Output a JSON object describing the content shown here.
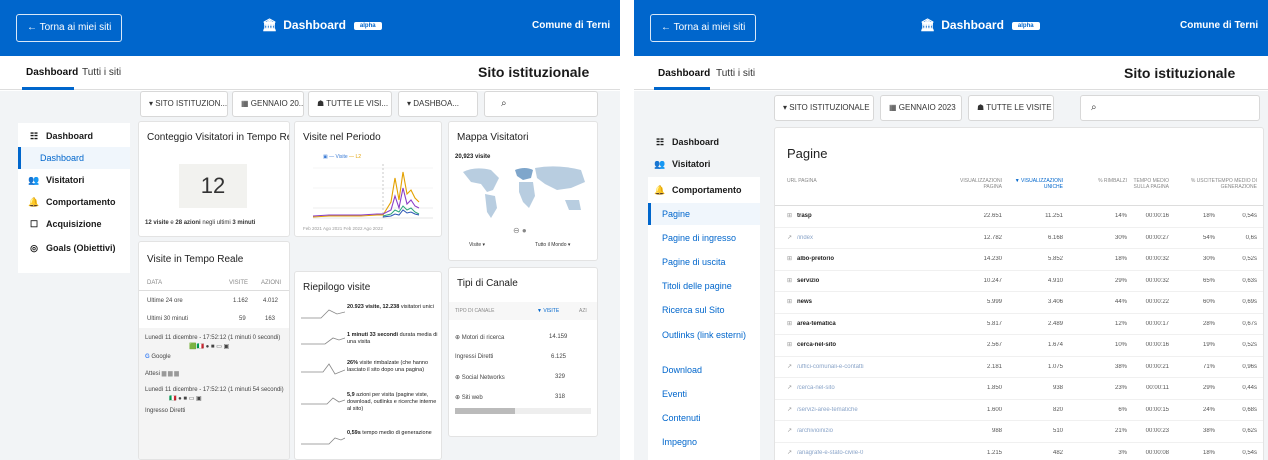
{
  "left": {
    "topbar": {
      "back_label": "← Torna ai miei siti",
      "brand": "Dashboard",
      "badge": "alpha",
      "org": "Comune di Terni"
    },
    "tabs": [
      "Dashboard",
      "Tutti i siti"
    ],
    "site_title": "Sito istituzionale",
    "filters": [
      "▾ SITO ISTITUZION...",
      "▦ GENNAIO 20...",
      "☗ TUTTE LE VISI...",
      "▾ DASHBOA..."
    ],
    "sidebar": {
      "items": [
        "Dashboard",
        "Visitatori",
        "Comportamento",
        "Acquisizione",
        "Goals (Obiettivi)"
      ],
      "sub": "Dashboard"
    },
    "realtime": {
      "title": "Conteggio Visitatori in Tempo Reale",
      "count": "12",
      "summary_a": "12 visite",
      "summary_b": " e ",
      "summary_c": "28 azioni",
      "summary_d": " negli ultimi ",
      "summary_e": "3 minuti"
    },
    "period": {
      "title": "Visite nel Periodo",
      "legend1": "Visite",
      "legend2": "L2",
      "xlabels": "Feb 2021 Ago 2021 Feb 2022 Ago 2022"
    },
    "map": {
      "title": "Mappa Visitatori",
      "visits": "20,923 visite",
      "sel1": "Visite",
      "sel2": "Tutto il Mondo"
    },
    "live": {
      "title": "Visite in Tempo Reale",
      "head": [
        "DATA",
        "VISITE",
        "AZIONI"
      ],
      "rows": [
        [
          "Ultime 24 ore",
          "1.162",
          "4.012"
        ],
        [
          "Ultimi 30 minuti",
          "59",
          "163"
        ]
      ],
      "v1": "Lunedì 11 dicembre - 17:52:12 (1 minuti 0 secondi)",
      "g": "Google",
      "v2": "Attesi",
      "v3": "Lunedì 11 dicembre - 17:52:12 (1 minuti 54 secondi)",
      "v4": "Ingresso Diretti"
    },
    "summary": {
      "title": "Riepilogo visite",
      "items": [
        {
          "strong": "20.923 visite, 12.238",
          "rest": " visitatori unici"
        },
        {
          "strong": "1 minuti 33 secondi",
          "rest": " durata media di una visita"
        },
        {
          "strong": "26%",
          "rest": " visite rimbalzate (che hanno lasciato il sito dopo una pagina)"
        },
        {
          "strong": "5,9",
          "rest": " azioni per visita (pagine viste, download, outlinks e ricerche interne al sito)"
        },
        {
          "strong": "0,59s",
          "rest": " tempo medio di generazione"
        }
      ]
    },
    "channels": {
      "title": "Tipi di Canale",
      "head": [
        "TIPO DI CANALE",
        "▼ VISITE",
        "AZI"
      ],
      "rows": [
        [
          "Motori di ricerca",
          "14.159"
        ],
        [
          "Ingressi Diretti",
          "6.125"
        ],
        [
          "Social Networks",
          "329"
        ],
        [
          "Siti web",
          "318"
        ]
      ]
    }
  },
  "right": {
    "topbar": {
      "back_label": "← Torna ai miei siti",
      "brand": "Dashboard",
      "badge": "alpha",
      "org": "Comune di Terni"
    },
    "tabs": [
      "Dashboard",
      "Tutti i siti"
    ],
    "site_title": "Sito istituzionale",
    "filters": [
      "▾ SITO ISTITUZIONALE",
      "▦ GENNAIO 2023",
      "☗ TUTTE LE VISITE"
    ],
    "sidebar": {
      "items": [
        "Dashboard",
        "Visitatori",
        "Comportamento"
      ],
      "subs": [
        "Pagine",
        "Pagine di ingresso",
        "Pagine di uscita",
        "Titoli delle pagine",
        "Ricerca sul Sito",
        "Outlinks (link esterni)",
        "Download",
        "Eventi",
        "Contenuti",
        "Impegno"
      ]
    },
    "pages": {
      "title": "Pagine",
      "head": [
        "URL PAGINA",
        "VISUALIZZAZIONI PAGINA",
        "▼ VISUALIZZAZIONI UNICHE",
        "% RIMBALZI",
        "TEMPO MEDIO SULLA PAGINA",
        "% USCITE",
        "TEMPO MEDIO DI GENERAZIONE"
      ],
      "rows": [
        [
          "trasp",
          "22.651",
          "11.251",
          "14%",
          "00:00:16",
          "18%",
          "0,54s"
        ],
        [
          "/index",
          "12.782",
          "6.168",
          "30%",
          "00:00:27",
          "54%",
          "0,6s"
        ],
        [
          "albo-pretorio",
          "14.230",
          "5.852",
          "18%",
          "00:00:32",
          "30%",
          "0,52s"
        ],
        [
          "servizio",
          "10.247",
          "4.910",
          "29%",
          "00:00:32",
          "65%",
          "0,63s"
        ],
        [
          "news",
          "5.999",
          "3.406",
          "44%",
          "00:00:22",
          "60%",
          "0,69s"
        ],
        [
          "area-tematica",
          "5.817",
          "2.489",
          "12%",
          "00:00:17",
          "28%",
          "0,67s"
        ],
        [
          "cerca-nel-sito",
          "2.567",
          "1.674",
          "10%",
          "00:00:16",
          "19%",
          "0,52s"
        ],
        [
          "/uffici-comunali-e-contatti",
          "2.181",
          "1.075",
          "38%",
          "00:00:21",
          "71%",
          "0,96s"
        ],
        [
          "/cerca-nel-sito",
          "1.850",
          "938",
          "23%",
          "00:00:11",
          "29%",
          "0,44s"
        ],
        [
          "/servizi-aree-tematiche",
          "1.600",
          "820",
          "6%",
          "00:00:15",
          "24%",
          "0,68s"
        ],
        [
          "/archivioinizio",
          "988",
          "510",
          "21%",
          "00:00:23",
          "38%",
          "0,62s"
        ],
        [
          "/anagrafe-e-stato-civile-0",
          "1.215",
          "482",
          "3%",
          "00:00:08",
          "18%",
          "0,54s"
        ]
      ]
    }
  }
}
